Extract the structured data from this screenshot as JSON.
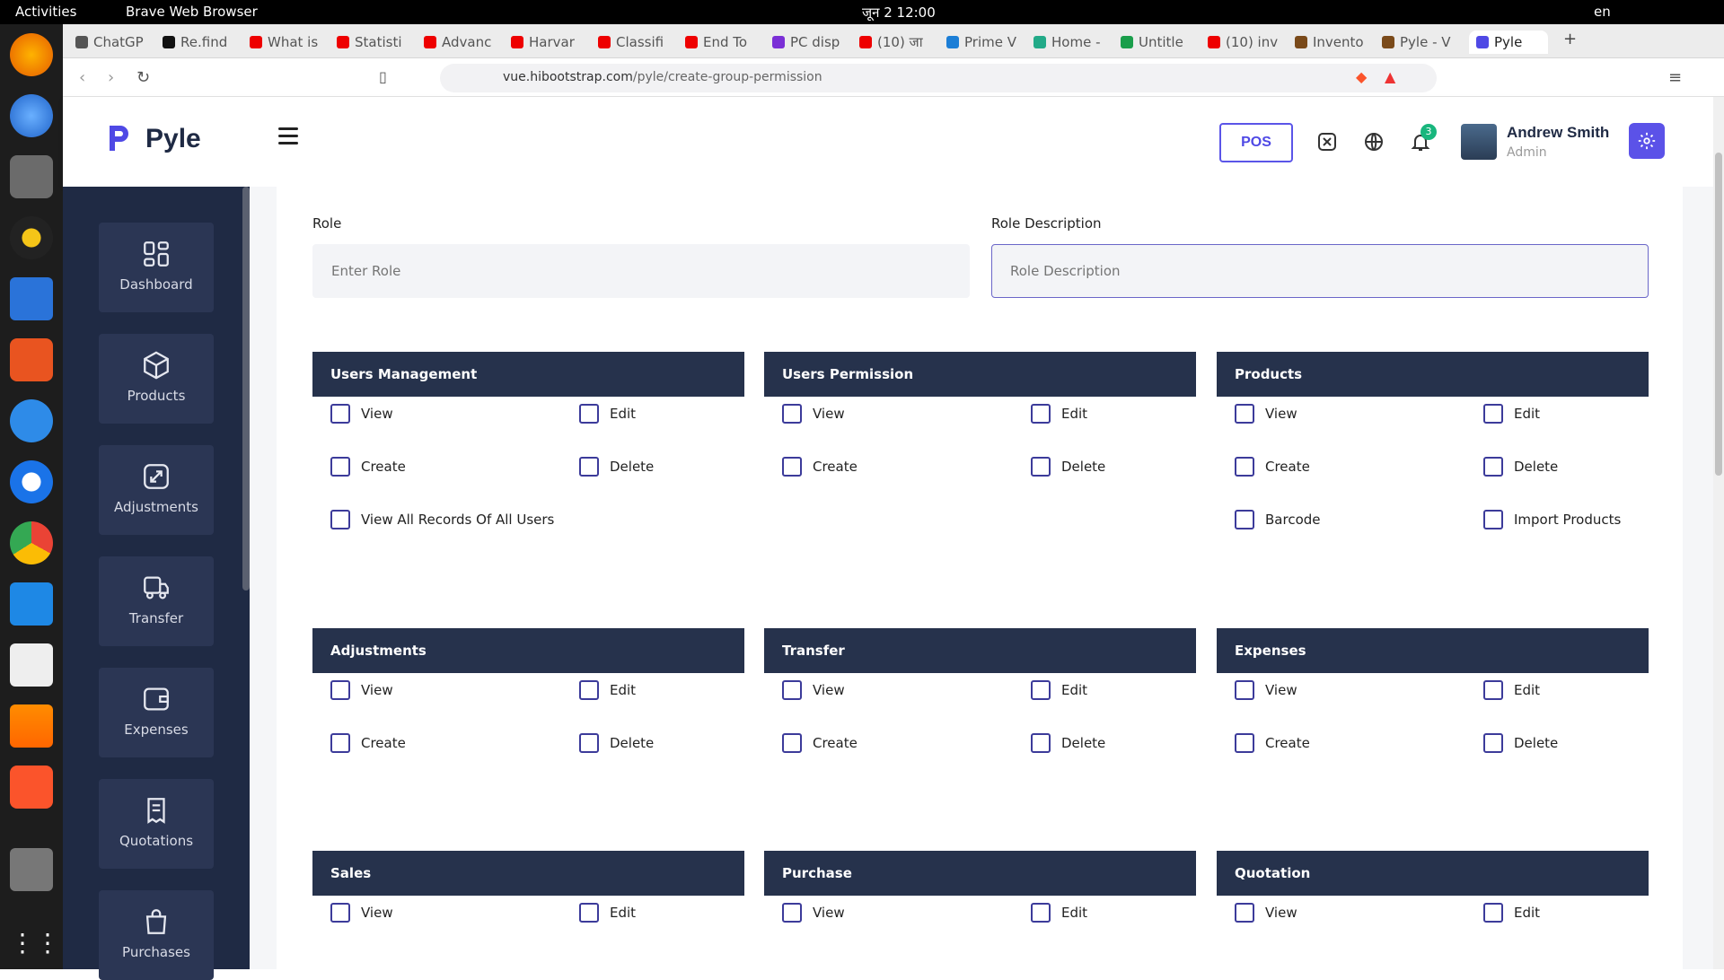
{
  "os": {
    "activities": "Activities",
    "app_name": "Brave Web Browser",
    "clock": "जून 2  12:00",
    "lang": "en"
  },
  "browser": {
    "tabs": [
      {
        "label": "ChatGP",
        "color": "#555"
      },
      {
        "label": "Re.find",
        "color": "#111"
      },
      {
        "label": "What is",
        "color": "#e00"
      },
      {
        "label": "Statisti",
        "color": "#e00"
      },
      {
        "label": "Advanc",
        "color": "#e00"
      },
      {
        "label": "Harvar",
        "color": "#e00"
      },
      {
        "label": "Classifi",
        "color": "#e00"
      },
      {
        "label": "End To",
        "color": "#e00"
      },
      {
        "label": "PC disp",
        "color": "#7b2fd6"
      },
      {
        "label": "(10) जा",
        "color": "#e00"
      },
      {
        "label": "Prime V",
        "color": "#1c7ed6"
      },
      {
        "label": "Home -",
        "color": "#2a8"
      },
      {
        "label": "Untitle",
        "color": "#1a9e4b"
      },
      {
        "label": "(10) inv",
        "color": "#e00"
      },
      {
        "label": "Invento",
        "color": "#7a4a1a"
      },
      {
        "label": "Pyle - V",
        "color": "#7a4a1a"
      },
      {
        "label": "Pyle",
        "color": "#4f49e5"
      }
    ],
    "url_host": "vue.hibootstrap.com",
    "url_path": "/pyle/create-group-permission"
  },
  "header": {
    "logo": "Pyle",
    "pos_label": "POS",
    "notif_count": "3",
    "user_name": "Andrew Smith",
    "user_role": "Admin"
  },
  "sidebar": {
    "items": [
      "Dashboard",
      "Products",
      "Adjustments",
      "Transfer",
      "Expenses",
      "Quotations",
      "Purchases"
    ]
  },
  "form": {
    "role_label": "Role",
    "role_placeholder": "Enter Role",
    "desc_label": "Role Description",
    "desc_placeholder": "Role Description"
  },
  "groups": [
    {
      "title": "Users Management",
      "perms": [
        "View",
        "Edit",
        "Create",
        "Delete",
        "View All Records Of All Users"
      ]
    },
    {
      "title": "Users Permission",
      "perms": [
        "View",
        "Edit",
        "Create",
        "Delete"
      ]
    },
    {
      "title": "Products",
      "perms": [
        "View",
        "Edit",
        "Create",
        "Delete",
        "Barcode",
        "Import Products"
      ]
    },
    {
      "title": "Adjustments",
      "perms": [
        "View",
        "Edit",
        "Create",
        "Delete"
      ]
    },
    {
      "title": "Transfer",
      "perms": [
        "View",
        "Edit",
        "Create",
        "Delete"
      ]
    },
    {
      "title": "Expenses",
      "perms": [
        "View",
        "Edit",
        "Create",
        "Delete"
      ]
    },
    {
      "title": "Sales",
      "perms": [
        "View",
        "Edit"
      ]
    },
    {
      "title": "Purchase",
      "perms": [
        "View",
        "Edit"
      ]
    },
    {
      "title": "Quotation",
      "perms": [
        "View",
        "Edit"
      ]
    }
  ]
}
